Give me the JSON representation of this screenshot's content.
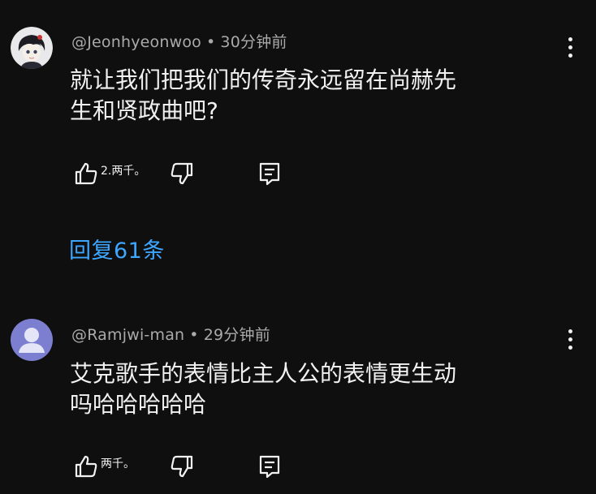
{
  "comments": [
    {
      "author": "@Jeonhyeonwoo",
      "separator": "•",
      "time": "30分钟前",
      "text": "就让我们把我们的传奇永远留在尚赫先\n生和贤政曲吧?",
      "like_count": "2.两千。",
      "replies_label": "回复61条",
      "avatar": "anime-character-avatar"
    },
    {
      "author": "@Ramjwi-man",
      "separator": "•",
      "time": "29分钟前",
      "text": "艾克歌手的表情比主人公的表情更生动\n吗哈哈哈哈哈",
      "like_count": "两千。",
      "avatar": "default-user-avatar",
      "avatar_color": "#7c7fd0"
    }
  ],
  "icons": {
    "like": "thumbs-up-icon",
    "dislike": "thumbs-down-icon",
    "reply": "reply-icon",
    "more": "more-vertical-icon"
  }
}
